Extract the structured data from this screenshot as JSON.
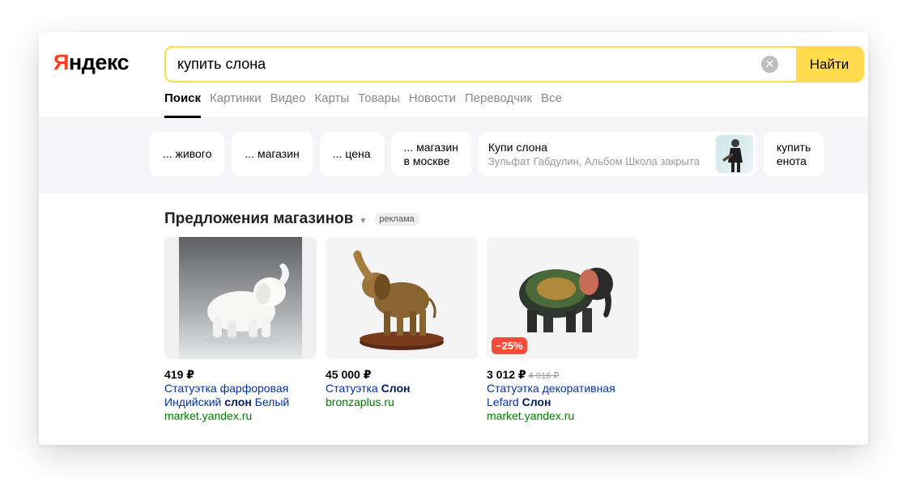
{
  "header": {
    "logo_first": "Я",
    "logo_rest": "ндекс",
    "search_value": "купить слона",
    "clear_glyph": "✕",
    "find_label": "Найти"
  },
  "tabs": [
    {
      "label": "Поиск",
      "active": true
    },
    {
      "label": "Картинки"
    },
    {
      "label": "Видео"
    },
    {
      "label": "Карты"
    },
    {
      "label": "Товары"
    },
    {
      "label": "Новости"
    },
    {
      "label": "Переводчик"
    },
    {
      "label": "Все"
    }
  ],
  "suggestions": {
    "chip1": "... живого",
    "chip2": "... магазин",
    "chip3": "... цена",
    "chip4_line1": "... магазин",
    "chip4_line2": "в москве",
    "song_title": "Купи слона",
    "song_sub": "Зульфат Габдулин, Альбом Школа закрыта",
    "chip6_line1": "купить",
    "chip6_line2": "енота"
  },
  "shop": {
    "title": "Предложения магазинов",
    "caret": "▼",
    "ad_label": "реклама",
    "products": [
      {
        "price": "419 ₽",
        "name_a": "Статуэтка фарфоровая Индийский ",
        "name_b": "слон",
        "name_c": " Белый",
        "domain": "market.yandex.ru"
      },
      {
        "price": "45 000 ₽",
        "name_a": "Статуэтка ",
        "name_b": "Слон",
        "name_c": "",
        "domain": "bronzaplus.ru"
      },
      {
        "price": "3 012 ₽",
        "old_price": "4 016 ₽",
        "discount": "−25%",
        "name_a": "Статуэтка декоративная Lefard ",
        "name_b": "Слон",
        "name_c": "",
        "domain": "market.yandex.ru"
      }
    ]
  },
  "colors": {
    "accent": "#ffdb4d",
    "logo_red": "#fc3f1d",
    "link": "#0033a0",
    "domain": "#007700",
    "discount": "#f34b38"
  }
}
